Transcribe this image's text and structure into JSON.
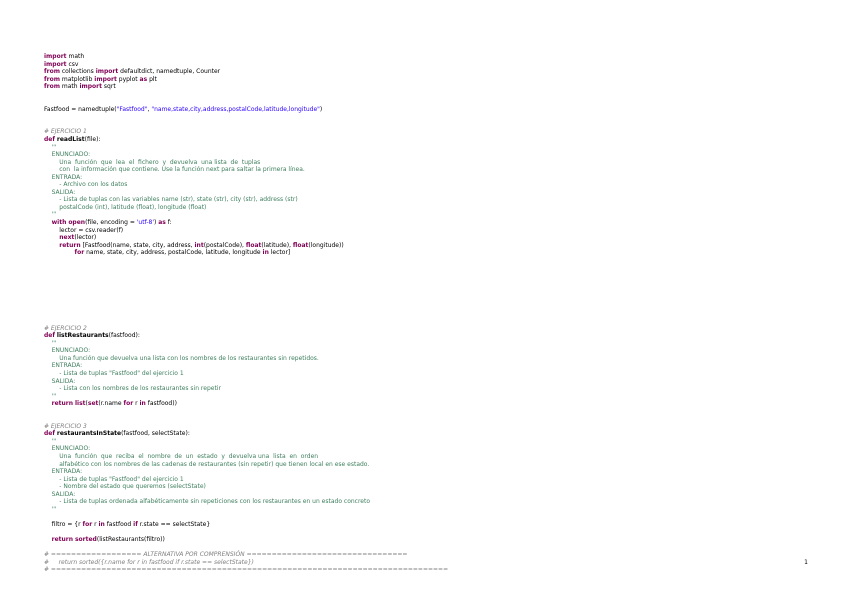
{
  "document": {
    "page_number": "1",
    "lines": [
      [
        {
          "t": "kw",
          "v": "import"
        },
        {
          "t": "tx",
          "v": " math"
        }
      ],
      [
        {
          "t": "kw",
          "v": "import"
        },
        {
          "t": "tx",
          "v": " csv"
        }
      ],
      [
        {
          "t": "kw",
          "v": "from"
        },
        {
          "t": "tx",
          "v": " collections "
        },
        {
          "t": "kw",
          "v": "import"
        },
        {
          "t": "tx",
          "v": " defaultdict, namedtuple, Counter"
        }
      ],
      [
        {
          "t": "kw",
          "v": "from"
        },
        {
          "t": "tx",
          "v": " matplotlib "
        },
        {
          "t": "kw",
          "v": "import"
        },
        {
          "t": "tx",
          "v": " pyplot "
        },
        {
          "t": "kw",
          "v": "as"
        },
        {
          "t": "tx",
          "v": " plt"
        }
      ],
      [
        {
          "t": "kw",
          "v": "from"
        },
        {
          "t": "tx",
          "v": " math "
        },
        {
          "t": "kw",
          "v": "import"
        },
        {
          "t": "tx",
          "v": " sqrt"
        }
      ],
      [],
      [],
      [
        {
          "t": "tx",
          "v": "Fastfood = namedtuple("
        },
        {
          "t": "str",
          "v": "\"Fastfood\""
        },
        {
          "t": "tx",
          "v": ", "
        },
        {
          "t": "str",
          "v": "\"name,state,city,address,postalCode,latitude,longitude\""
        },
        {
          "t": "tx",
          "v": ")"
        }
      ],
      [],
      [],
      [
        {
          "t": "cm",
          "v": "# EJERCICIO 1"
        }
      ],
      [
        {
          "t": "kw",
          "v": "def"
        },
        {
          "t": "tx",
          "v": " "
        },
        {
          "t": "fn",
          "v": "readList"
        },
        {
          "t": "tx",
          "v": "(file):"
        }
      ],
      [
        {
          "t": "doc",
          "v": "    '''"
        }
      ],
      [
        {
          "t": "doc",
          "v": "    ENUNCIADO:"
        }
      ],
      [
        {
          "t": "doc",
          "v": "        Una  función  que  lea  el  fichero  y  devuelva  una lista  de  tuplas"
        }
      ],
      [
        {
          "t": "doc",
          "v": "        con  la información que contiene. Use la función next para saltar la primera línea."
        }
      ],
      [
        {
          "t": "doc",
          "v": "    ENTRADA:"
        }
      ],
      [
        {
          "t": "doc",
          "v": "        - Archivo con los datos"
        }
      ],
      [
        {
          "t": "doc",
          "v": "    SALIDA:"
        }
      ],
      [
        {
          "t": "doc",
          "v": "        - Lista de tuplas con las variables name (str), state (str), city (str), address (str)"
        }
      ],
      [
        {
          "t": "doc",
          "v": "        postalCode (int), latitude (float), longitude (float)"
        }
      ],
      [
        {
          "t": "doc",
          "v": "    '''"
        }
      ],
      [
        {
          "t": "tx",
          "v": "    "
        },
        {
          "t": "kw",
          "v": "with"
        },
        {
          "t": "tx",
          "v": " "
        },
        {
          "t": "kw",
          "v": "open"
        },
        {
          "t": "tx",
          "v": "(file, encoding = "
        },
        {
          "t": "str",
          "v": "'utf-8'"
        },
        {
          "t": "tx",
          "v": ") "
        },
        {
          "t": "kw",
          "v": "as"
        },
        {
          "t": "tx",
          "v": " f:"
        }
      ],
      [
        {
          "t": "tx",
          "v": "        lector = csv.reader(f)"
        }
      ],
      [
        {
          "t": "tx",
          "v": "        "
        },
        {
          "t": "kw",
          "v": "next"
        },
        {
          "t": "tx",
          "v": "(lector)"
        }
      ],
      [
        {
          "t": "tx",
          "v": "        "
        },
        {
          "t": "kw",
          "v": "return"
        },
        {
          "t": "tx",
          "v": " [Fastfood(name, state, city, address, "
        },
        {
          "t": "kw",
          "v": "int"
        },
        {
          "t": "tx",
          "v": "(postalCode), "
        },
        {
          "t": "kw",
          "v": "float"
        },
        {
          "t": "tx",
          "v": "(latitude), "
        },
        {
          "t": "kw",
          "v": "float"
        },
        {
          "t": "tx",
          "v": "(longitude))"
        }
      ],
      [
        {
          "t": "tx",
          "v": "                "
        },
        {
          "t": "kw",
          "v": "for"
        },
        {
          "t": "tx",
          "v": " name, state, city, address, postalCode, latitude, longitude "
        },
        {
          "t": "kw",
          "v": "in"
        },
        {
          "t": "tx",
          "v": " lector]"
        }
      ],
      [],
      [],
      [],
      [],
      [],
      [],
      [],
      [],
      [],
      [
        {
          "t": "cm",
          "v": "# EJERCICIO 2"
        }
      ],
      [
        {
          "t": "kw",
          "v": "def"
        },
        {
          "t": "tx",
          "v": " "
        },
        {
          "t": "fn",
          "v": "listRestaurants"
        },
        {
          "t": "tx",
          "v": "(fastfood):"
        }
      ],
      [
        {
          "t": "doc",
          "v": "    '''"
        }
      ],
      [
        {
          "t": "doc",
          "v": "    ENUNCIADO:"
        }
      ],
      [
        {
          "t": "doc",
          "v": "        Una función que devuelva una lista con los nombres de los restaurantes sin repetidos."
        }
      ],
      [
        {
          "t": "doc",
          "v": "    ENTRADA:"
        }
      ],
      [
        {
          "t": "doc",
          "v": "        - Lista de tuplas \"Fastfood\" del ejercicio 1"
        }
      ],
      [
        {
          "t": "doc",
          "v": "    SALIDA:"
        }
      ],
      [
        {
          "t": "doc",
          "v": "        - Lista con los nombres de los restaurantes sin repetir"
        }
      ],
      [
        {
          "t": "doc",
          "v": "    '''"
        }
      ],
      [
        {
          "t": "tx",
          "v": "    "
        },
        {
          "t": "kw",
          "v": "return"
        },
        {
          "t": "tx",
          "v": " "
        },
        {
          "t": "kw",
          "v": "list"
        },
        {
          "t": "tx",
          "v": "("
        },
        {
          "t": "kw",
          "v": "set"
        },
        {
          "t": "tx",
          "v": "(r.name "
        },
        {
          "t": "kw",
          "v": "for"
        },
        {
          "t": "tx",
          "v": " r "
        },
        {
          "t": "kw",
          "v": "in"
        },
        {
          "t": "tx",
          "v": " fastfood))"
        }
      ],
      [],
      [],
      [
        {
          "t": "cm",
          "v": "# EJERCICIO 3"
        }
      ],
      [
        {
          "t": "kw",
          "v": "def"
        },
        {
          "t": "tx",
          "v": " "
        },
        {
          "t": "fn",
          "v": "restaurantsInState"
        },
        {
          "t": "tx",
          "v": "(fastfood, selectState):"
        }
      ],
      [
        {
          "t": "doc",
          "v": "    '''"
        }
      ],
      [
        {
          "t": "doc",
          "v": "    ENUNCIADO:"
        }
      ],
      [
        {
          "t": "doc",
          "v": "        Una  función  que  reciba  el  nombre  de  un  estado  y  devuelva una  lista  en  orden"
        }
      ],
      [
        {
          "t": "doc",
          "v": "        alfabético con los nombres de las cadenas de restaurantes (sin repetir) que tienen local en ese estado."
        }
      ],
      [
        {
          "t": "doc",
          "v": "    ENTRADA:"
        }
      ],
      [
        {
          "t": "doc",
          "v": "        - Lista de tuplas \"Fastfood\" del ejercicio 1"
        }
      ],
      [
        {
          "t": "doc",
          "v": "        - Nombre del estado que queremos (selectState)"
        }
      ],
      [
        {
          "t": "doc",
          "v": "    SALIDA:"
        }
      ],
      [
        {
          "t": "doc",
          "v": "        - Lista de tuplas ordenada alfabéticamente sin repeticiones con los restaurantes en un estado concreto"
        }
      ],
      [
        {
          "t": "doc",
          "v": "    '''"
        }
      ],
      [],
      [
        {
          "t": "tx",
          "v": "    filtro = {r "
        },
        {
          "t": "kw",
          "v": "for"
        },
        {
          "t": "tx",
          "v": " r "
        },
        {
          "t": "kw",
          "v": "in"
        },
        {
          "t": "tx",
          "v": " fastfood "
        },
        {
          "t": "kw",
          "v": "if"
        },
        {
          "t": "tx",
          "v": " r.state == selectState}"
        }
      ],
      [],
      [
        {
          "t": "tx",
          "v": "    "
        },
        {
          "t": "kw",
          "v": "return"
        },
        {
          "t": "tx",
          "v": " "
        },
        {
          "t": "kw",
          "v": "sorted"
        },
        {
          "t": "tx",
          "v": "(listRestaurants(filtro))"
        }
      ],
      [],
      [
        {
          "t": "cm",
          "v": "# ================== ALTERNATIVA POR COMPRENSIÓN ================================"
        }
      ],
      [
        {
          "t": "cm",
          "v": "#     return sorted({r.name for r in fastfood if r.state == selectState})"
        }
      ],
      [
        {
          "t": "cm",
          "v": "# ==============================================================================="
        }
      ]
    ]
  }
}
